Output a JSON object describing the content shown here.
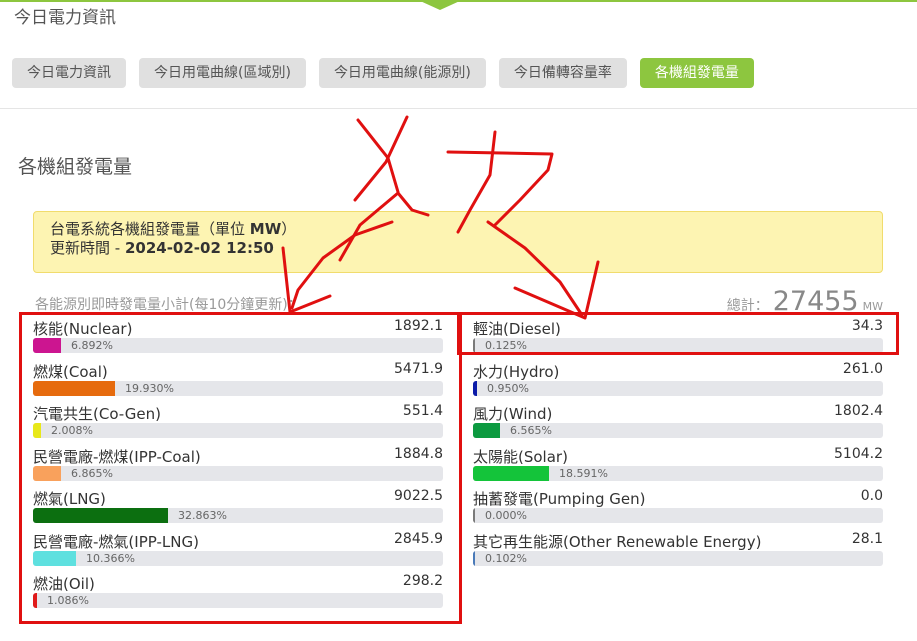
{
  "page": {
    "top_title": "今日電力資訊",
    "section_title": "各機組發電量",
    "accent_color": "#8dc63f"
  },
  "tabs": [
    {
      "label": "今日電力資訊",
      "active": false
    },
    {
      "label": "今日用電曲線(區域別)",
      "active": false
    },
    {
      "label": "今日用電曲線(能源別)",
      "active": false
    },
    {
      "label": "今日備轉容量率",
      "active": false
    },
    {
      "label": "各機組發電量",
      "active": true
    }
  ],
  "info": {
    "line1_prefix": "台電系統各機組發電量（單位 ",
    "unit": "MW",
    "line1_suffix": "）",
    "update_label": "更新時間 - ",
    "update_time": "2024-02-02 12:50"
  },
  "subtotal_label": "各能源別即時發電量小計(每10分鐘更新)：",
  "total": {
    "label": "總計：",
    "value": "27455",
    "unit": "MW"
  },
  "left_sources": [
    {
      "name": "核能(Nuclear)",
      "value": "1892.1",
      "percent": "6.892%",
      "fraction": 0.06892,
      "color": "#cc1590"
    },
    {
      "name": "燃煤(Coal)",
      "value": "5471.9",
      "percent": "19.930%",
      "fraction": 0.1993,
      "color": "#e66b0e"
    },
    {
      "name": "汽電共生(Co-Gen)",
      "value": "551.4",
      "percent": "2.008%",
      "fraction": 0.02008,
      "color": "#e8e81a"
    },
    {
      "name": "民營電廠-燃煤(IPP-Coal)",
      "value": "1884.8",
      "percent": "6.865%",
      "fraction": 0.06865,
      "color": "#f9a15c"
    },
    {
      "name": "燃氣(LNG)",
      "value": "9022.5",
      "percent": "32.863%",
      "fraction": 0.32863,
      "color": "#0c6f10"
    },
    {
      "name": "民營電廠-燃氣(IPP-LNG)",
      "value": "2845.9",
      "percent": "10.366%",
      "fraction": 0.10366,
      "color": "#5ee0df"
    },
    {
      "name": "燃油(Oil)",
      "value": "298.2",
      "percent": "1.086%",
      "fraction": 0.01086,
      "color": "#e01a1a"
    }
  ],
  "right_sources": [
    {
      "name": "輕油(Diesel)",
      "value": "34.3",
      "percent": "0.125%",
      "fraction": 0.00125,
      "color": "#7a7a7a"
    },
    {
      "name": "水力(Hydro)",
      "value": "261.0",
      "percent": "0.950%",
      "fraction": 0.0095,
      "color": "#0b1ba8"
    },
    {
      "name": "風力(Wind)",
      "value": "1802.4",
      "percent": "6.565%",
      "fraction": 0.06565,
      "color": "#0c9a40"
    },
    {
      "name": "太陽能(Solar)",
      "value": "5104.2",
      "percent": "18.591%",
      "fraction": 0.18591,
      "color": "#14c43a"
    },
    {
      "name": "抽蓄發電(Pumping Gen)",
      "value": "0.0",
      "percent": "0.000%",
      "fraction": 0.0,
      "color": "#7a7a7a"
    },
    {
      "name": "其它再生能源(Other Renewable Energy)",
      "value": "28.1",
      "percent": "0.102%",
      "fraction": 0.00102,
      "color": "#4a7ab8"
    }
  ],
  "annotation": {
    "handwritten_text": "火力",
    "color": "#e01010"
  }
}
